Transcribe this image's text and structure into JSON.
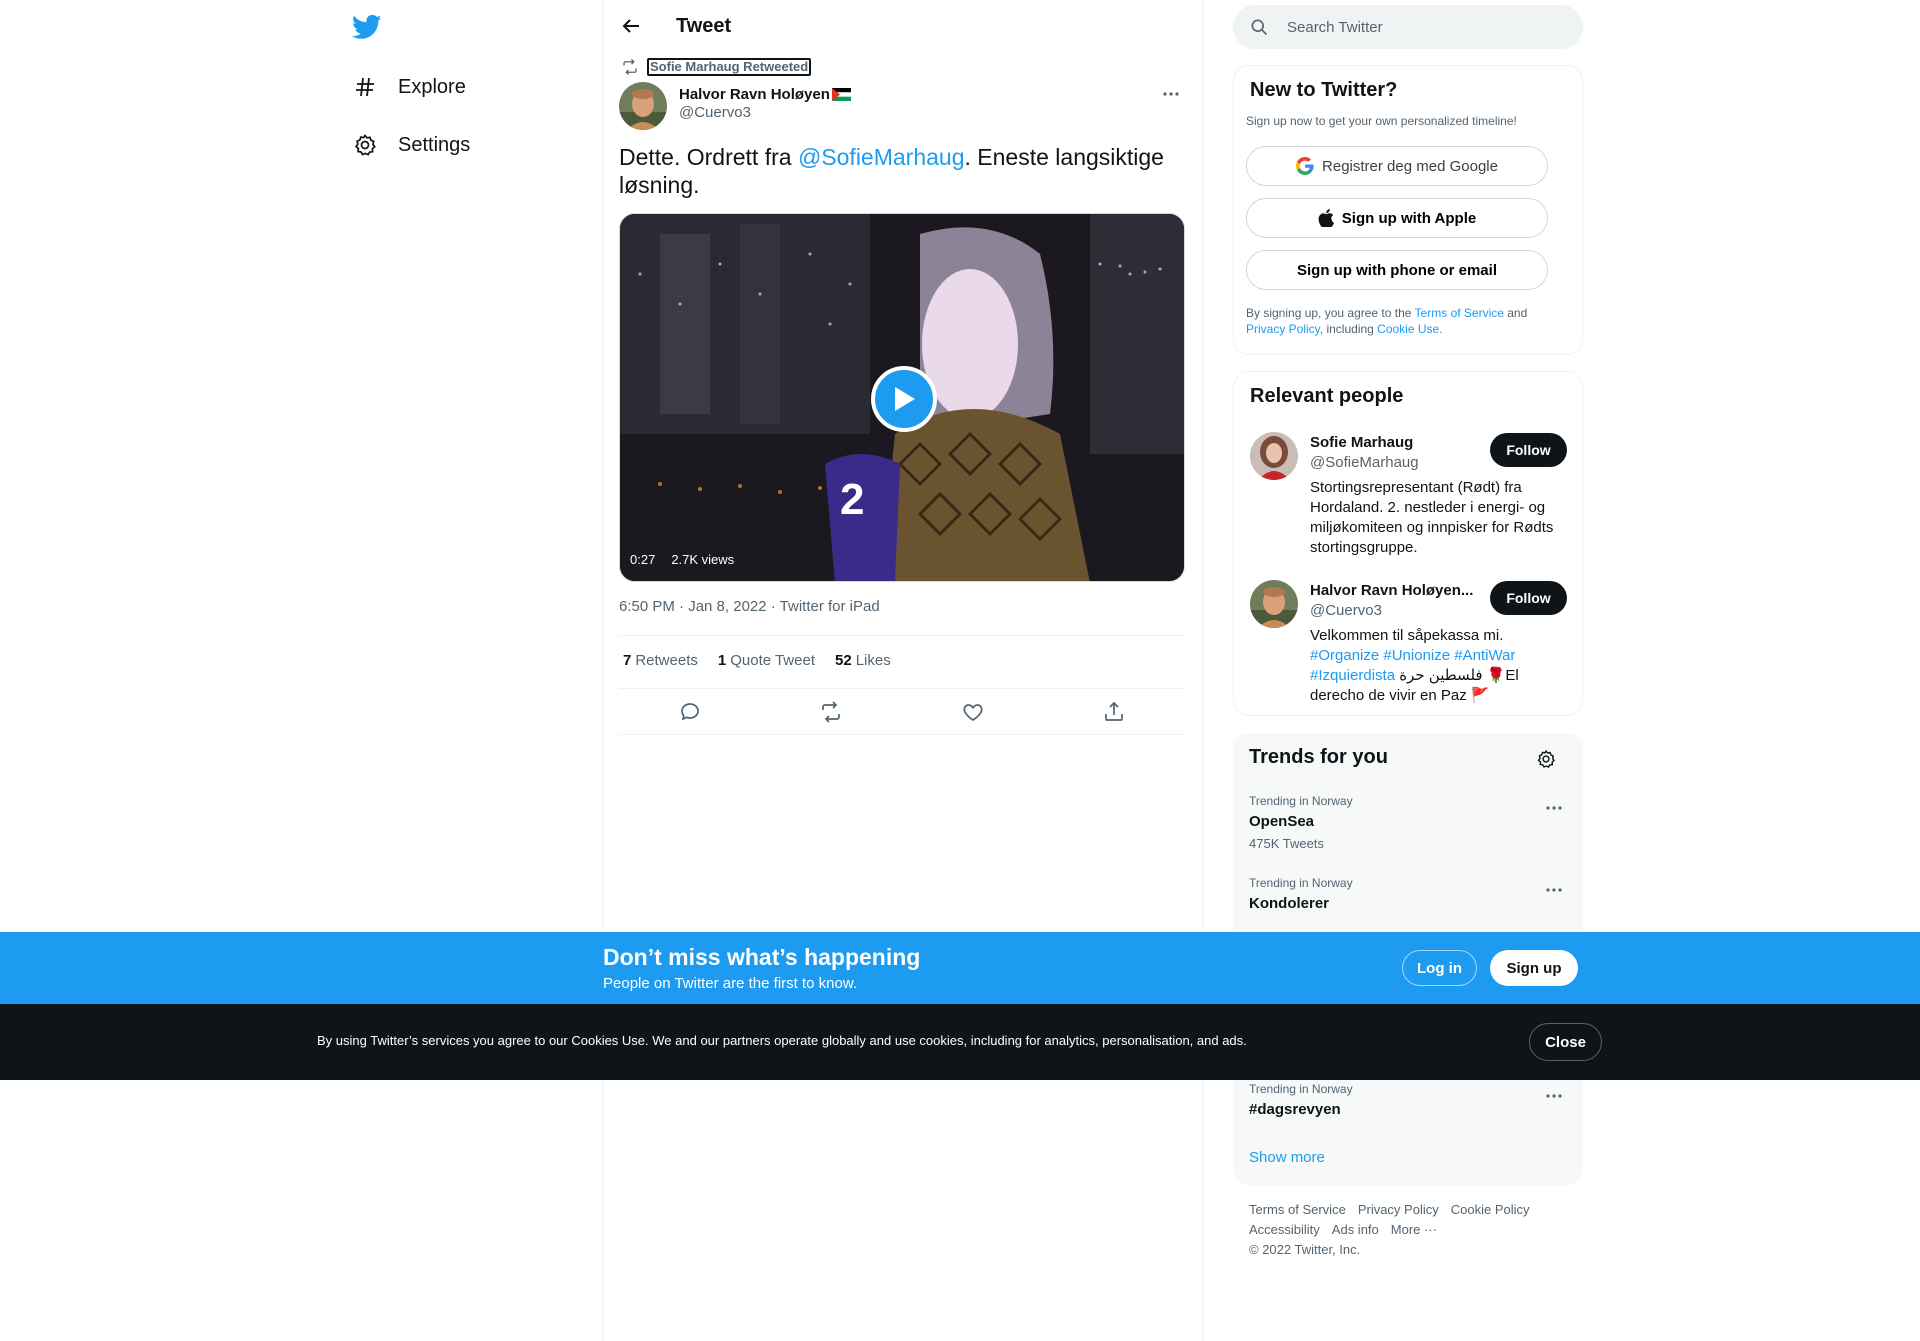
{
  "nav": {
    "items": [
      {
        "label": "Explore",
        "icon": "hashtag-icon"
      },
      {
        "label": "Settings",
        "icon": "gear-icon"
      }
    ]
  },
  "header": {
    "title": "Tweet"
  },
  "tweet": {
    "retweeted_by": "Sofie Marhaug Retweeted",
    "author_name": "Halvor Ravn Holøyen",
    "author_handle": "@Cuervo3",
    "text_before": "Dette. Ordrett fra ",
    "mention": "@SofieMarhaug",
    "text_after": ". Eneste langsiktige løsning.",
    "video_duration": "0:27",
    "video_views": "2.7K views",
    "timestamp": "6:50 PM · Jan 8, 2022 · Twitter for iPad",
    "stats": {
      "retweets_count": "7",
      "retweets_label": "Retweets",
      "quotes_count": "1",
      "quotes_label": "Quote Tweet",
      "likes_count": "52",
      "likes_label": "Likes"
    }
  },
  "search": {
    "placeholder": "Search Twitter"
  },
  "signup": {
    "title": "New to Twitter?",
    "subtitle": "Sign up now to get your own personalized timeline!",
    "google_label": "Registrer deg med Google",
    "apple_label": "Sign up with Apple",
    "phone_label": "Sign up with phone or email",
    "terms_1": "By signing up, you agree to the ",
    "terms_link_1": "Terms of Service",
    "terms_2": " and ",
    "terms_link_2": "Privacy Policy",
    "terms_3": ", including ",
    "terms_link_3": "Cookie Use."
  },
  "people": {
    "title": "Relevant people",
    "list": [
      {
        "name": "Sofie Marhaug",
        "handle": "@SofieMarhaug",
        "bio": "Stortingsrepresentant (Rødt) fra Hordaland. 2. nestleder i energi- og miljøkomiteen og innpisker for Rødts stortingsgruppe.",
        "follow_label": "Follow"
      },
      {
        "name": "Halvor Ravn Holøyen...",
        "handle": "@Cuervo3",
        "bio_1": "Velkommen til såpekassa mi.",
        "tags": "#Organize #Unionize #AntiWar #Izquierdista",
        "bio_2": " فلسطين حرة 🌹El derecho de vivir en Paz 🚩",
        "follow_label": "Follow"
      }
    ]
  },
  "trends": {
    "title": "Trends for you",
    "list": [
      {
        "context": "Trending in Norway",
        "name": "OpenSea",
        "count": "475K Tweets"
      },
      {
        "context": "Trending in Norway",
        "name": "Kondolerer"
      },
      {
        "context": "Trending in Norway",
        "name": "#dagsrevyen"
      }
    ],
    "show_more": "Show more"
  },
  "footer": {
    "links": [
      "Terms of Service",
      "Privacy Policy",
      "Cookie Policy",
      "Accessibility",
      "Ads info",
      "More ···"
    ],
    "copyright": "© 2022 Twitter, Inc."
  },
  "banner": {
    "title": "Don’t miss what’s happening",
    "subtitle": "People on Twitter are the first to know.",
    "login_label": "Log in",
    "signup_label": "Sign up"
  },
  "cookie": {
    "text": "By using Twitter’s services you agree to our Cookies Use. We and our partners operate globally and use cookies, including for analytics, personalisation, and ads.",
    "close_label": "Close"
  },
  "colors": {
    "accent": "#1d9bf0",
    "text": "#0f1419",
    "muted": "#536471"
  }
}
